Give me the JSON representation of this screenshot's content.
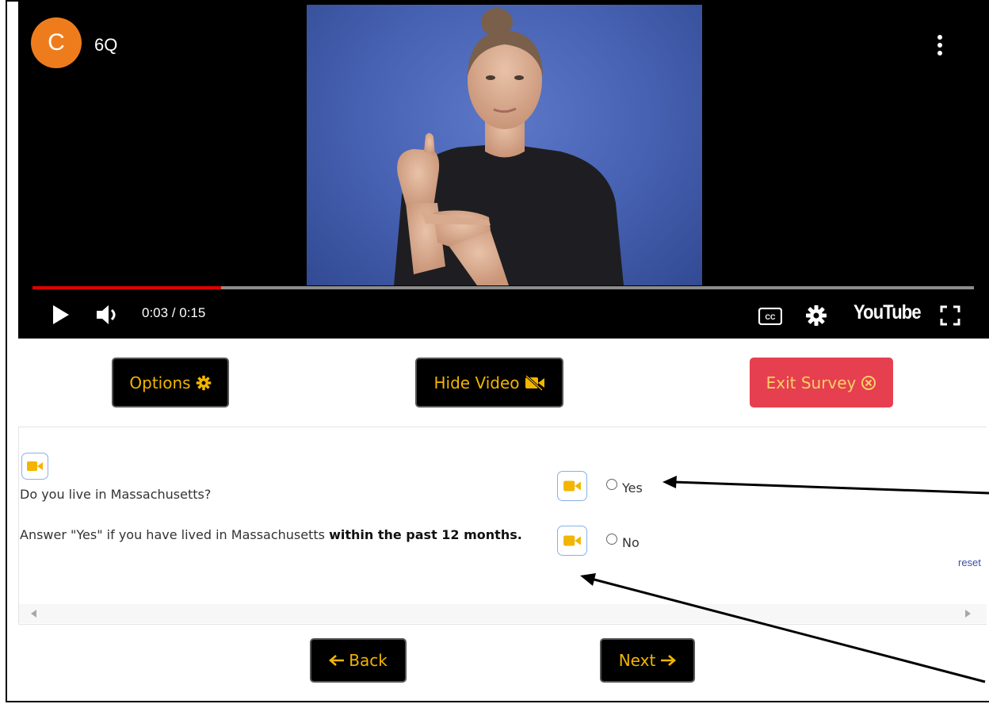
{
  "video": {
    "channel_initial": "C",
    "title": "6Q",
    "time_current": "0:03",
    "time_total": "0:15",
    "time_text": "0:03 / 0:15",
    "progress_fraction": 0.2,
    "brand_logo": "YouTube",
    "icons": [
      "play-icon",
      "volume-icon",
      "captions-icon",
      "settings-gear-icon",
      "fullscreen-icon",
      "more-vert-icon"
    ]
  },
  "toolbar": {
    "options_label": "Options",
    "hide_video_label": "Hide Video",
    "exit_survey_label": "Exit Survey"
  },
  "question": {
    "text": "Do you live in Massachusetts?",
    "hint_prefix": "Answer \"Yes\" if you have lived in Massachusetts ",
    "hint_bold": "within the past 12 months.",
    "options": [
      {
        "label": "Yes",
        "selected": false
      },
      {
        "label": "No",
        "selected": false
      }
    ],
    "reset_label": "reset"
  },
  "nav": {
    "back_label": "Back",
    "next_label": "Next"
  },
  "colors": {
    "accent_gold": "#f2b500",
    "exit_red": "#e63f4f",
    "progress_red": "#e00000",
    "avatar_orange": "#ef7c1c"
  }
}
